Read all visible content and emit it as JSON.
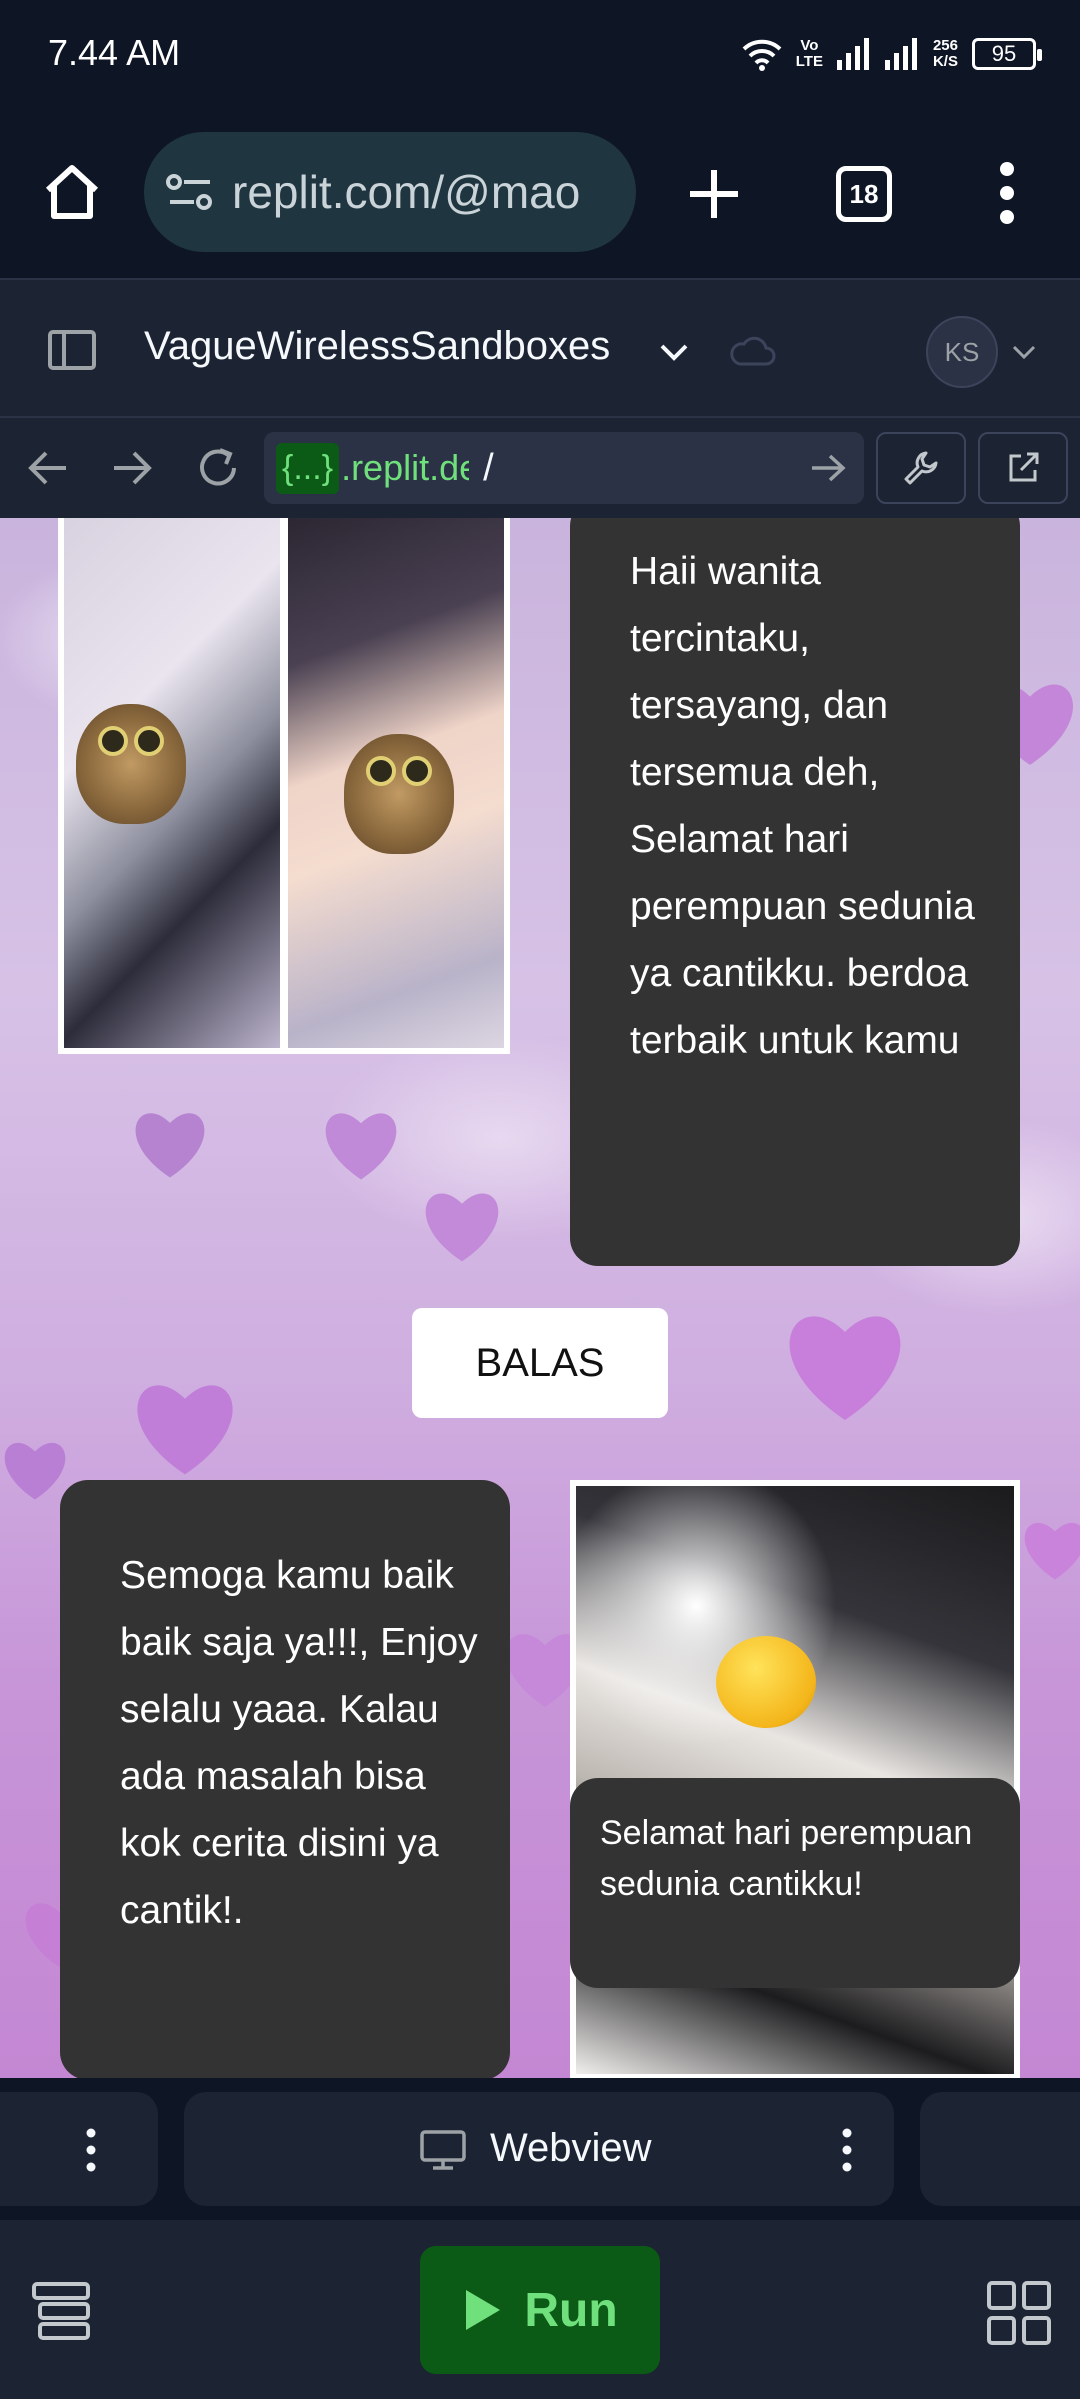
{
  "status_bar": {
    "time": "7.44 AM",
    "volte_top": "Vo",
    "volte_bottom": "LTE",
    "speed_top": "256",
    "speed_bottom": "K/S",
    "battery": "95"
  },
  "browser": {
    "url": "replit.com/@mao",
    "tab_count": "18"
  },
  "replit_header": {
    "repl_name": "VagueWirelessSandboxes",
    "avatar_initials": "KS"
  },
  "webview_nav": {
    "url_badge": "{...}",
    "url_host": ".replit.dev",
    "url_path": "/"
  },
  "page": {
    "message_1": "Haii wanita tercintaku, tersayang, dan tersemua deh, Selamat hari perempuan sedunia ya cantikku. berdoa terbaik untuk kamu",
    "reply_button": "BALAS",
    "message_2": "Semoga kamu baik baik saja ya!!!, Enjoy selalu yaaa. Kalau ada masalah bisa kok cerita disini ya cantik!.",
    "caption": "Selamat hari perempuan sedunia cantikku!"
  },
  "panes": {
    "active_tab": "Webview"
  },
  "toolbar": {
    "run_label": "Run"
  },
  "colors": {
    "app_bg": "#0e1525",
    "panel_bg": "#1c2333",
    "run_bg": "#0b5b17",
    "run_text": "#6fe07c",
    "card_bg": "#333333"
  }
}
